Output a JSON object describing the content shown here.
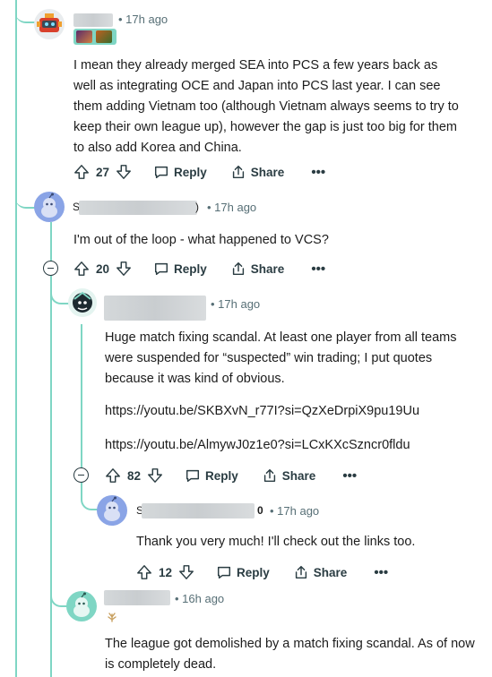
{
  "comments": [
    {
      "time": "• 17h ago",
      "body": "I mean they already merged SEA into PCS a few years back as well as integrating OCE and Japan into PCS last year. I can see them adding Vietnam too (although Vietnam always seems to try to keep their own league up), however the gap is just too big for them to also add Korea and China.",
      "votes": "27",
      "reply": "Reply",
      "share": "Share"
    },
    {
      "name_start": "S",
      "name_end": ")",
      "time": "• 17h ago",
      "body": "I'm out of the loop - what happened to VCS?",
      "votes": "20",
      "reply": "Reply",
      "share": "Share"
    },
    {
      "time": "• 17h ago",
      "body": "Huge match fixing scandal. At least one player from all teams were suspended for “suspected” win trading; I put quotes because it was kind of obvious.",
      "link1": "https://youtu.be/SKBXvN_r77I?si=QzXeDrpiX9pu19Uu",
      "link2": "https://youtu.be/AlmywJ0z1e0?si=LCxKXcSzncr0fldu",
      "votes": "82",
      "reply": "Reply",
      "share": "Share"
    },
    {
      "name_start": "S",
      "name_end": "0",
      "time": "• 17h ago",
      "body": "Thank you very much! I'll check out the links too.",
      "votes": "12",
      "reply": "Reply",
      "share": "Share"
    },
    {
      "time": "• 16h ago",
      "body": "The league got demolished by a match fixing scandal. As of now is completely dead."
    }
  ],
  "icons": {
    "upvote": "upvote-icon",
    "downvote": "downvote-icon",
    "reply": "reply-bubble-icon",
    "share": "share-icon",
    "more": "more-dots-icon",
    "collapse": "collapse-minus-icon"
  },
  "colors": {
    "thread_line": "#7fd6c4",
    "meta_text": "#576f76",
    "avatar_snoo": "#8aa4e6"
  }
}
